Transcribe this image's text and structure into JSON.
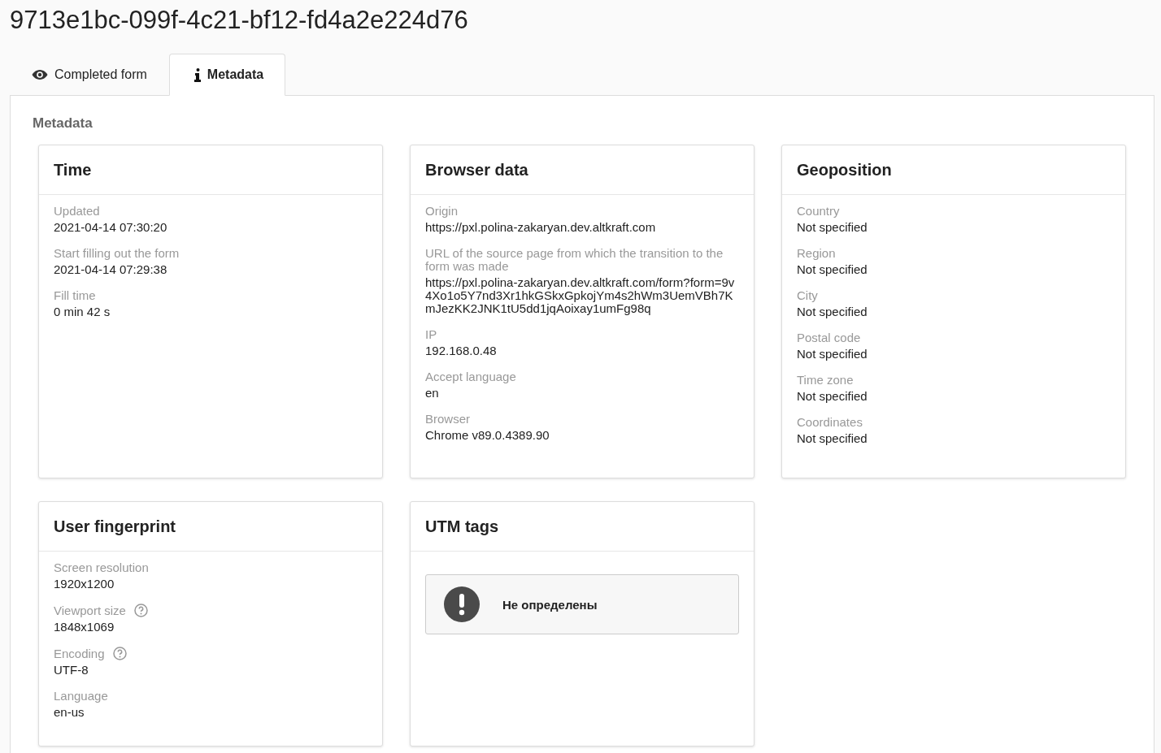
{
  "title": "9713e1bc-099f-4c21-bf12-fd4a2e224d76",
  "tabs": [
    {
      "label": "Completed form",
      "selected": false
    },
    {
      "label": "Metadata",
      "selected": true
    }
  ],
  "section_title": "Metadata",
  "cards": [
    {
      "kind": "fields",
      "title": "Time",
      "fields": [
        {
          "label": "Updated",
          "value": "2021-04-14 07:30:20"
        },
        {
          "label": "Start filling out the form",
          "value": "2021-04-14 07:29:38"
        },
        {
          "label": "Fill time",
          "value": "0 min 42 s"
        }
      ]
    },
    {
      "kind": "fields",
      "title": "Browser data",
      "fields": [
        {
          "label": "Origin",
          "value": "https://pxl.polina-zakaryan.dev.altkraft.com"
        },
        {
          "label": "URL of the source page from which the transition to the form was made",
          "value": "https://pxl.polina-zakaryan.dev.altkraft.com/form?form=9v4Xo1o5Y7nd3Xr1hkGSkxGpkojYm4s2hWm3UemVBh7KmJezKK2JNK1tU5dd1jqAoixay1umFg98q"
        },
        {
          "label": "IP",
          "value": "192.168.0.48"
        },
        {
          "label": "Accept language",
          "value": "en"
        },
        {
          "label": "Browser",
          "value": "Chrome v89.0.4389.90"
        }
      ]
    },
    {
      "kind": "fields",
      "title": "Geoposition",
      "fields": [
        {
          "label": "Country",
          "value": "Not specified"
        },
        {
          "label": "Region",
          "value": "Not specified"
        },
        {
          "label": "City",
          "value": "Not specified"
        },
        {
          "label": "Postal code",
          "value": "Not specified"
        },
        {
          "label": "Time zone",
          "value": "Not specified"
        },
        {
          "label": "Coordinates",
          "value": "Not specified"
        }
      ]
    },
    {
      "kind": "fields",
      "title": "User fingerprint",
      "fields": [
        {
          "label": "Screen resolution",
          "value": "1920x1200"
        },
        {
          "label": "Viewport size",
          "value": "1848x1069",
          "help": true
        },
        {
          "label": "Encoding",
          "value": "UTF-8",
          "help": true
        },
        {
          "label": "Language",
          "value": "en-us"
        }
      ]
    },
    {
      "kind": "notice",
      "title": "UTM tags",
      "message": "Не определены"
    }
  ]
}
